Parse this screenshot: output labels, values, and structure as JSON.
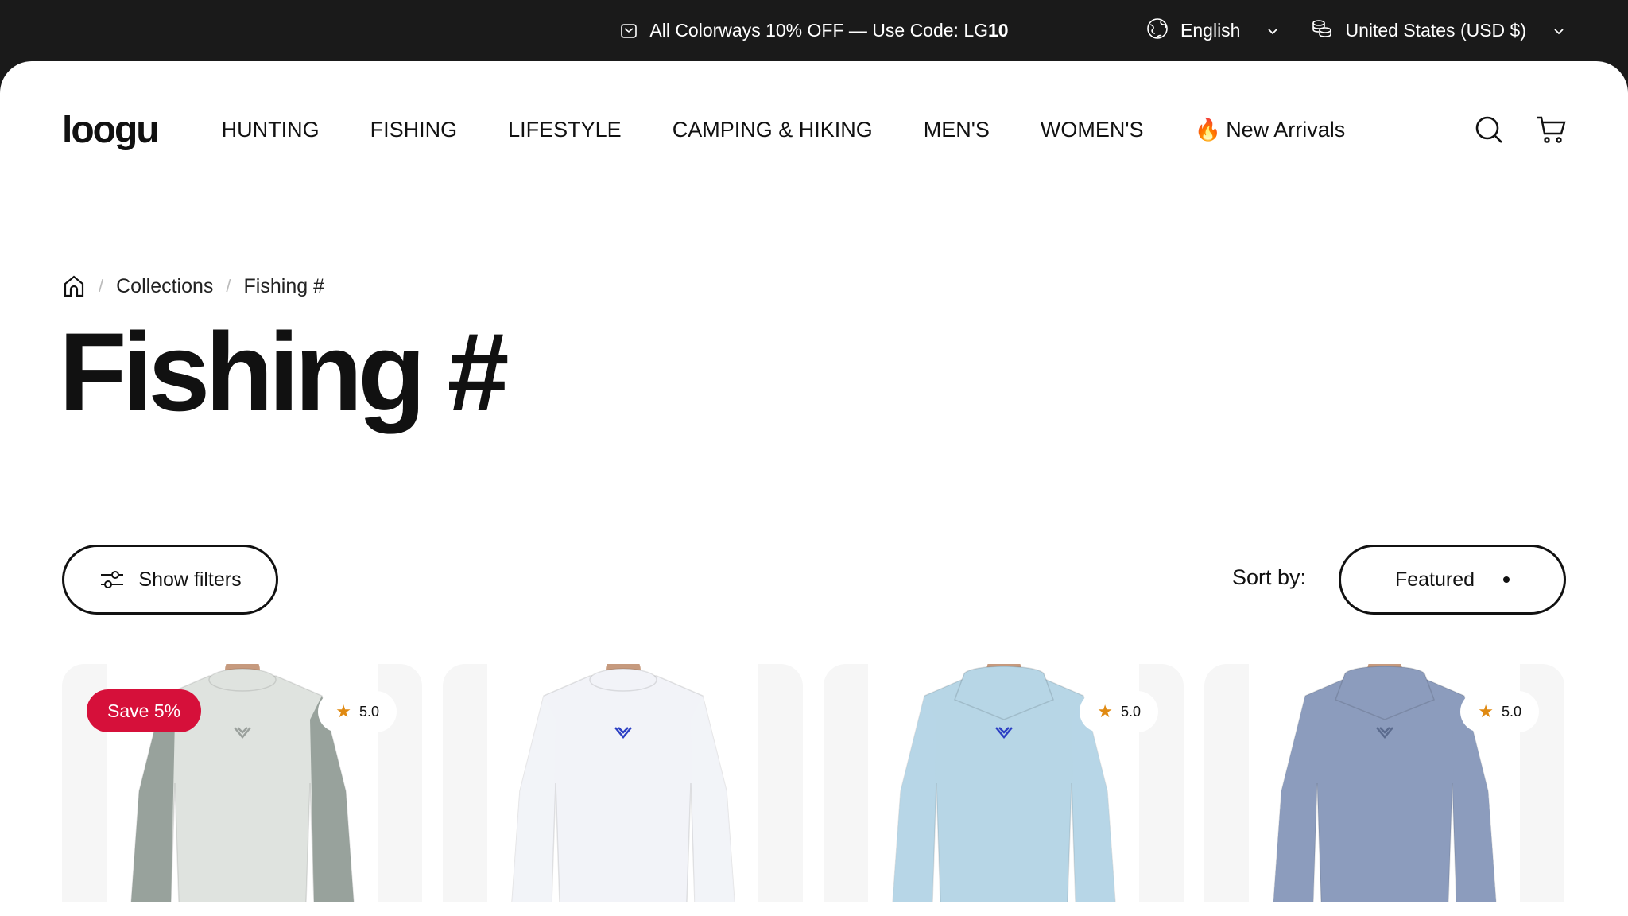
{
  "announcement": {
    "text": "All Colorways 10% OFF — Use Code: LG",
    "code_bold": "10",
    "icon": "mail-icon"
  },
  "locale": {
    "language": "English",
    "currency": "United States (USD $)",
    "language_icon": "globe-icon",
    "currency_icon": "coins-icon"
  },
  "header": {
    "logo": "loogu",
    "nav": [
      "HUNTING",
      "FISHING",
      "LIFESTYLE",
      "CAMPING & HIKING",
      "MEN'S",
      "WOMEN'S"
    ],
    "new_arrivals_emoji": "🔥",
    "new_arrivals": "New Arrivals",
    "icons": [
      "search-icon",
      "cart-icon"
    ]
  },
  "breadcrumb": {
    "items": [
      "Collections",
      "Fishing #"
    ]
  },
  "page": {
    "title": "Fishing #"
  },
  "toolbar": {
    "filters_label": "Show filters",
    "sort_label": "Sort by:",
    "sort_value": "Featured"
  },
  "products": [
    {
      "badge": "Save 5%",
      "rating": "5.0",
      "color": "#dfe3df",
      "sleeve": "#8c9690",
      "hood": false,
      "accent": "#9aa09c"
    },
    {
      "badge": "",
      "rating": "",
      "color": "#f2f3f8",
      "sleeve": "#f2f3f8",
      "hood": false,
      "accent": "#2c3fc4"
    },
    {
      "badge": "",
      "rating": "5.0",
      "color": "#b7d6e6",
      "sleeve": "#b7d6e6",
      "hood": true,
      "accent": "#2c3fc4"
    },
    {
      "badge": "",
      "rating": "5.0",
      "color": "#8c9cbd",
      "sleeve": "#8c9cbd",
      "hood": true,
      "accent": "#5b6b8e"
    }
  ],
  "colors": {
    "topbar": "#1a1a1a",
    "sale_badge": "#d6103a",
    "star": "#e08a12"
  }
}
